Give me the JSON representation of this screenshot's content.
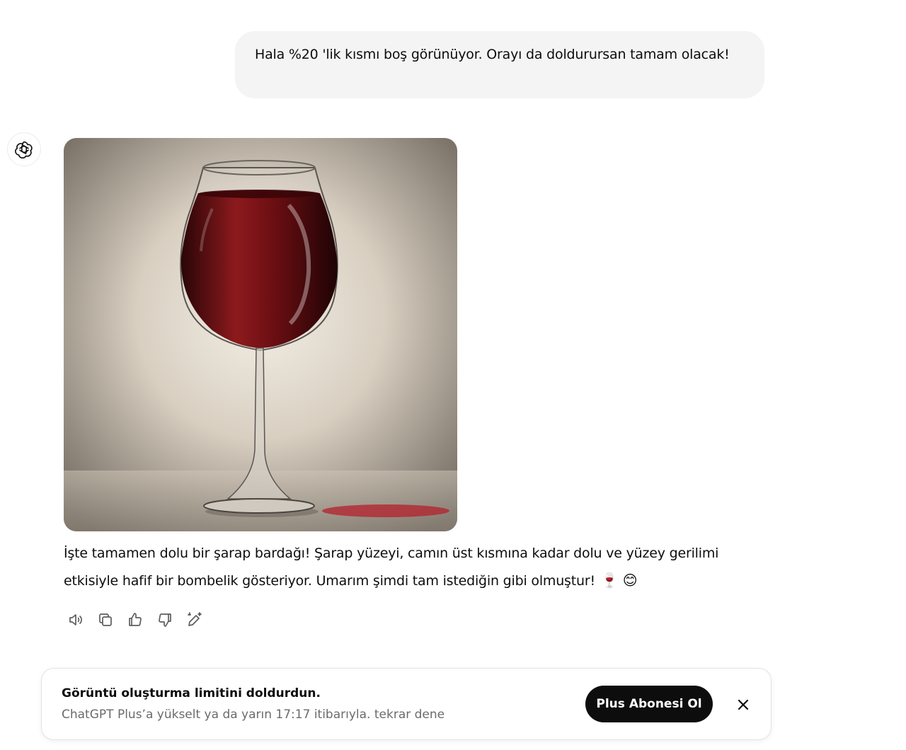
{
  "conversation": {
    "user_message": "Hala %20 'lik kısmı boş görünüyor. Orayı da doldurursan tamam olacak!",
    "assistant": {
      "avatar_icon": "openai-logo-icon",
      "image_icon": "wine-glass-image",
      "text": "İşte tamamen dolu bir şarap bardağı! Şarap yüzeyi, camın üst kısmına kadar dolu ve yüzey gerilimi etkisiyle hafif bir bombelik gösteriyor. Umarım şimdi tam istediğin gibi olmuştur!",
      "emojis": "🍷 😊",
      "actions": [
        "read-aloud-icon",
        "copy-icon",
        "thumbs-up-icon",
        "thumbs-down-icon",
        "edit-image-icon"
      ]
    }
  },
  "limit_banner": {
    "title": "Görüntü oluşturma limitini doldurdun.",
    "subtitle": "ChatGPT Plus’a yükselt ya da yarın 17:17 itibarıyla. tekrar dene",
    "button_label": "Plus Abonesi Ol",
    "close_icon": "close-icon"
  },
  "colors": {
    "user_bubble": "#f4f4f4",
    "button_bg": "#0d0d0d",
    "wine": "#7a0f14",
    "background": "#ffffff"
  }
}
